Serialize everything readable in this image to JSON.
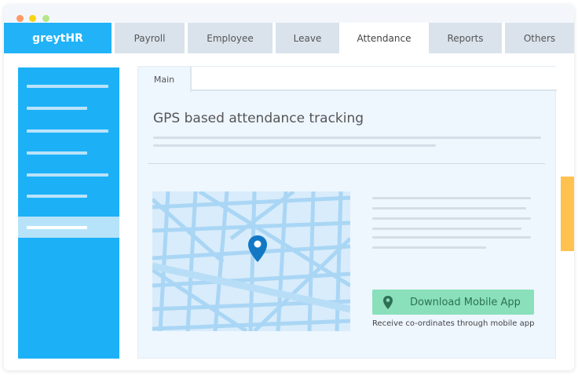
{
  "window": {
    "controls": [
      "close",
      "minimize",
      "maximize"
    ]
  },
  "logo": "greytHR",
  "nav": [
    {
      "label": "Payroll"
    },
    {
      "label": "Employee"
    },
    {
      "label": "Leave"
    },
    {
      "label": "Attendance",
      "active": true
    },
    {
      "label": "Reports"
    },
    {
      "label": "Others"
    }
  ],
  "main": {
    "tab": "Main",
    "title": "GPS based attendance tracking",
    "button": "Download Mobile App",
    "caption": "Receive co-ordinates through mobile app"
  },
  "colors": {
    "brand": "#21b2f8",
    "button": "#89e0bb",
    "accent": "#ffc24f"
  }
}
